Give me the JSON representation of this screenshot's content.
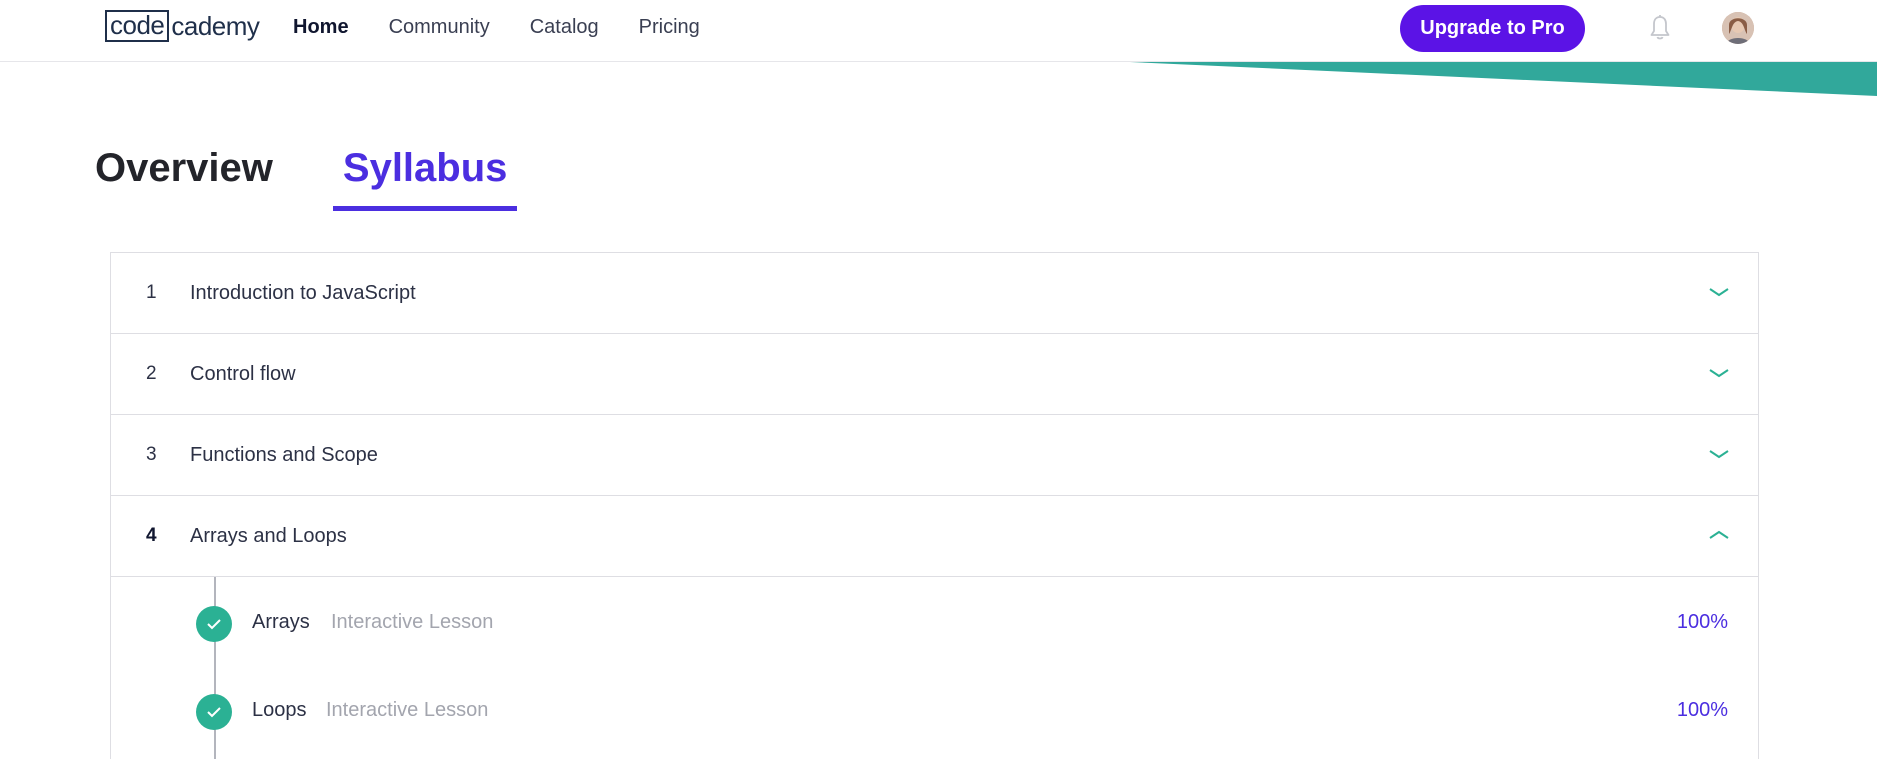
{
  "header": {
    "logo_boxed": "code",
    "logo_rest": "cademy",
    "nav": [
      "Home",
      "Community",
      "Catalog",
      "Pricing"
    ],
    "upgrade_label": "Upgrade to Pro",
    "bell_icon": "bell-icon",
    "avatar_icon": "user-avatar"
  },
  "tabs": {
    "overview": "Overview",
    "syllabus": "Syllabus",
    "active": "Syllabus"
  },
  "modules": [
    {
      "num": "1",
      "title": "Introduction to JavaScript",
      "state": "collapsed",
      "icon": "chevron-down-icon"
    },
    {
      "num": "2",
      "title": "Control flow",
      "state": "collapsed",
      "icon": "chevron-down-icon"
    },
    {
      "num": "3",
      "title": "Functions and Scope",
      "state": "collapsed",
      "icon": "chevron-down-icon"
    },
    {
      "num": "4",
      "title": "Arrays and Loops",
      "state": "expanded",
      "icon": "chevron-up-icon"
    }
  ],
  "lessons": [
    {
      "name": "Arrays",
      "type": "Interactive Lesson",
      "progress": "100%",
      "icon": "check-icon"
    },
    {
      "name": "Loops",
      "type": "Interactive Lesson",
      "progress": "100%",
      "icon": "check-icon"
    }
  ],
  "colors": {
    "brand_purple": "#5b13e6",
    "tab_active": "#4b2ee0",
    "teal": "#2bb194",
    "wedge": "#31a89b"
  }
}
